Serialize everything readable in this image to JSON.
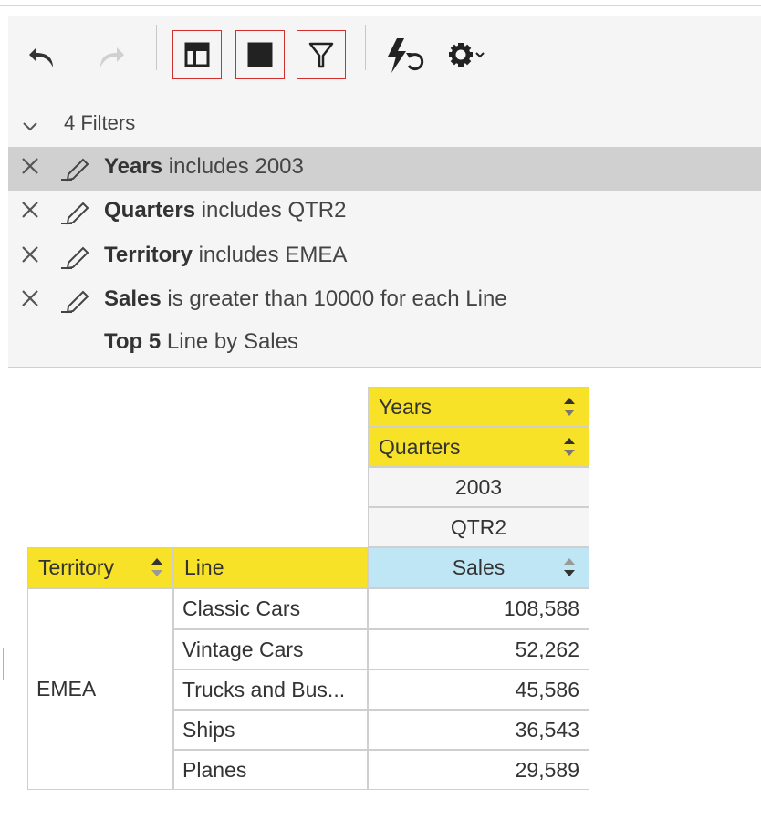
{
  "toolbar": {
    "buttons": [
      {
        "name": "undo-icon"
      },
      {
        "name": "redo-icon"
      },
      {
        "name": "layout-icon"
      },
      {
        "name": "table-layout-icon"
      },
      {
        "name": "filter-icon"
      },
      {
        "name": "auto-refresh-icon"
      },
      {
        "name": "settings-icon"
      }
    ]
  },
  "filters": {
    "header": "4 Filters",
    "items": [
      {
        "field": "Years",
        "rest": " includes 2003"
      },
      {
        "field": "Quarters",
        "rest": " includes QTR2"
      },
      {
        "field": "Territory",
        "rest": " includes EMEA"
      },
      {
        "field": "Sales",
        "rest": " is greater than 10000 for each Line"
      }
    ],
    "top": {
      "field": "Top 5",
      "rest": " Line by Sales"
    }
  },
  "pivot": {
    "col_fields": [
      "Years",
      "Quarters"
    ],
    "col_values": [
      "2003",
      "QTR2"
    ],
    "row_fields": [
      "Territory",
      "Line"
    ],
    "measure": "Sales",
    "territory": "EMEA",
    "rows": [
      {
        "line": "Classic Cars",
        "sales": "108,588"
      },
      {
        "line": "Vintage Cars",
        "sales": "52,262"
      },
      {
        "line": "Trucks and Bus...",
        "sales": "45,586"
      },
      {
        "line": "Ships",
        "sales": "36,543"
      },
      {
        "line": "Planes",
        "sales": "29,589"
      }
    ]
  }
}
